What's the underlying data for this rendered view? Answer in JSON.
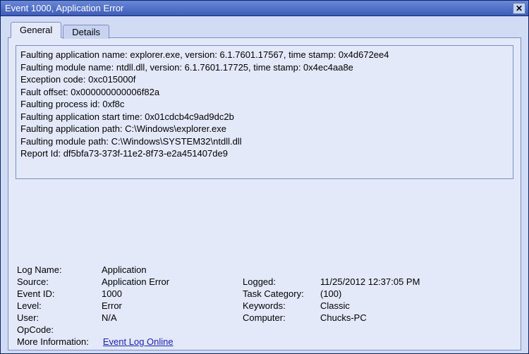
{
  "window": {
    "title": "Event 1000, Application Error"
  },
  "tabs": {
    "general": "General",
    "details": "Details"
  },
  "eventText": "Faulting application name: explorer.exe, version: 6.1.7601.17567, time stamp: 0x4d672ee4\nFaulting module name: ntdll.dll, version: 6.1.7601.17725, time stamp: 0x4ec4aa8e\nException code: 0xc015000f\nFault offset: 0x000000000006f82a\nFaulting process id: 0xf8c\nFaulting application start time: 0x01cdcb4c9ad9dc2b\nFaulting application path: C:\\Windows\\explorer.exe\nFaulting module path: C:\\Windows\\SYSTEM32\\ntdll.dll\nReport Id: df5bfa73-373f-11e2-8f73-e2a451407de9",
  "labels": {
    "logName": "Log Name:",
    "source": "Source:",
    "eventId": "Event ID:",
    "level": "Level:",
    "user": "User:",
    "opcode": "OpCode:",
    "logged": "Logged:",
    "taskCategory": "Task Category:",
    "keywords": "Keywords:",
    "computer": "Computer:",
    "moreInfo": "More Information:",
    "eventLogOnline": "Event Log Online"
  },
  "values": {
    "logName": "Application",
    "source": "Application Error",
    "eventId": "1000",
    "level": "Error",
    "user": "N/A",
    "opcode": "",
    "logged": "11/25/2012 12:37:05 PM",
    "taskCategory": "(100)",
    "keywords": "Classic",
    "computer": "Chucks-PC"
  }
}
